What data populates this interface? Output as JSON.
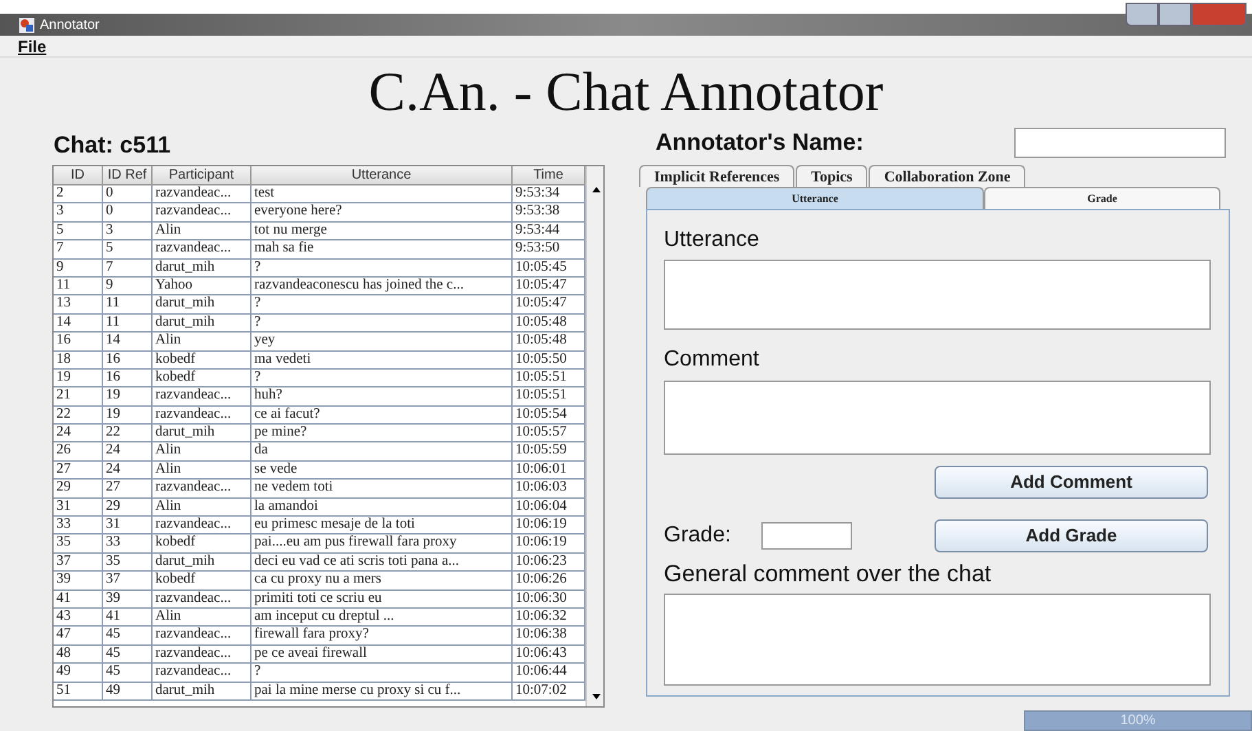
{
  "window": {
    "title": "Annotator"
  },
  "menu": [
    "File"
  ],
  "app_title": "C.An. - Chat Annotator",
  "chat_label": "Chat: c511",
  "table": {
    "columns": [
      "ID",
      "ID Ref",
      "Participant",
      "Utterance",
      "Time"
    ],
    "rows": [
      [
        "2",
        "0",
        "razvandeac...",
        "test",
        "9:53:34"
      ],
      [
        "3",
        "0",
        "razvandeac...",
        "everyone here?",
        "9:53:38"
      ],
      [
        "5",
        "3",
        "Alin",
        "tot nu merge",
        "9:53:44"
      ],
      [
        "7",
        "5",
        "razvandeac...",
        "mah sa fie",
        "9:53:50"
      ],
      [
        "9",
        "7",
        "darut_mih",
        "?",
        "10:05:45"
      ],
      [
        "11",
        "9",
        "Yahoo",
        "razvandeaconescu has joined the c...",
        "10:05:47"
      ],
      [
        "13",
        "11",
        "darut_mih",
        "?",
        "10:05:47"
      ],
      [
        "14",
        "11",
        "darut_mih",
        "?",
        "10:05:48"
      ],
      [
        "16",
        "14",
        "Alin",
        "yey",
        "10:05:48"
      ],
      [
        "18",
        "16",
        "kobedf",
        "ma vedeti",
        "10:05:50"
      ],
      [
        "19",
        "16",
        "kobedf",
        "?",
        "10:05:51"
      ],
      [
        "21",
        "19",
        "razvandeac...",
        "huh?",
        "10:05:51"
      ],
      [
        "22",
        "19",
        "razvandeac...",
        "ce ai facut?",
        "10:05:54"
      ],
      [
        "24",
        "22",
        "darut_mih",
        "pe mine?",
        "10:05:57"
      ],
      [
        "26",
        "24",
        "Alin",
        "da",
        "10:05:59"
      ],
      [
        "27",
        "24",
        "Alin",
        "se vede",
        "10:06:01"
      ],
      [
        "29",
        "27",
        "razvandeac...",
        "ne vedem toti",
        "10:06:03"
      ],
      [
        "31",
        "29",
        "Alin",
        "la amandoi",
        "10:06:04"
      ],
      [
        "33",
        "31",
        "razvandeac...",
        "eu primesc mesaje de la toti",
        "10:06:19"
      ],
      [
        "35",
        "33",
        "kobedf",
        "pai....eu am pus firewall fara proxy",
        "10:06:19"
      ],
      [
        "37",
        "35",
        "darut_mih",
        "deci eu vad ce ati scris toti pana a...",
        "10:06:23"
      ],
      [
        "39",
        "37",
        "kobedf",
        "ca cu proxy nu a mers",
        "10:06:26"
      ],
      [
        "41",
        "39",
        "razvandeac...",
        "primiti toti ce scriu eu",
        "10:06:30"
      ],
      [
        "43",
        "41",
        "Alin",
        "am inceput cu dreptul ...",
        "10:06:32"
      ],
      [
        "47",
        "45",
        "razvandeac...",
        "firewall fara proxy?",
        "10:06:38"
      ],
      [
        "48",
        "45",
        "razvandeac...",
        "pe ce aveai firewall",
        "10:06:43"
      ],
      [
        "49",
        "45",
        "razvandeac...",
        "?",
        "10:06:44"
      ],
      [
        "51",
        "49",
        "darut_mih",
        "pai la mine merse cu proxy si cu f...",
        "10:07:02"
      ]
    ]
  },
  "annotator_label": "Annotator's Name:",
  "tabs_top": [
    {
      "label": "Implicit References",
      "selected": false
    },
    {
      "label": "Topics",
      "selected": false
    },
    {
      "label": "Collaboration Zone",
      "selected": false
    }
  ],
  "tabs_bottom": [
    {
      "label": "Utterance",
      "selected": true
    },
    {
      "label": "Grade",
      "selected": false
    }
  ],
  "panel": {
    "utterance_label": "Utterance",
    "comment_label": "Comment",
    "add_comment": "Add Comment",
    "grade_label": "Grade:",
    "add_grade": "Add Grade",
    "general_label": "General comment over the chat"
  },
  "progress": {
    "level": 1.0,
    "reading": "100%"
  }
}
